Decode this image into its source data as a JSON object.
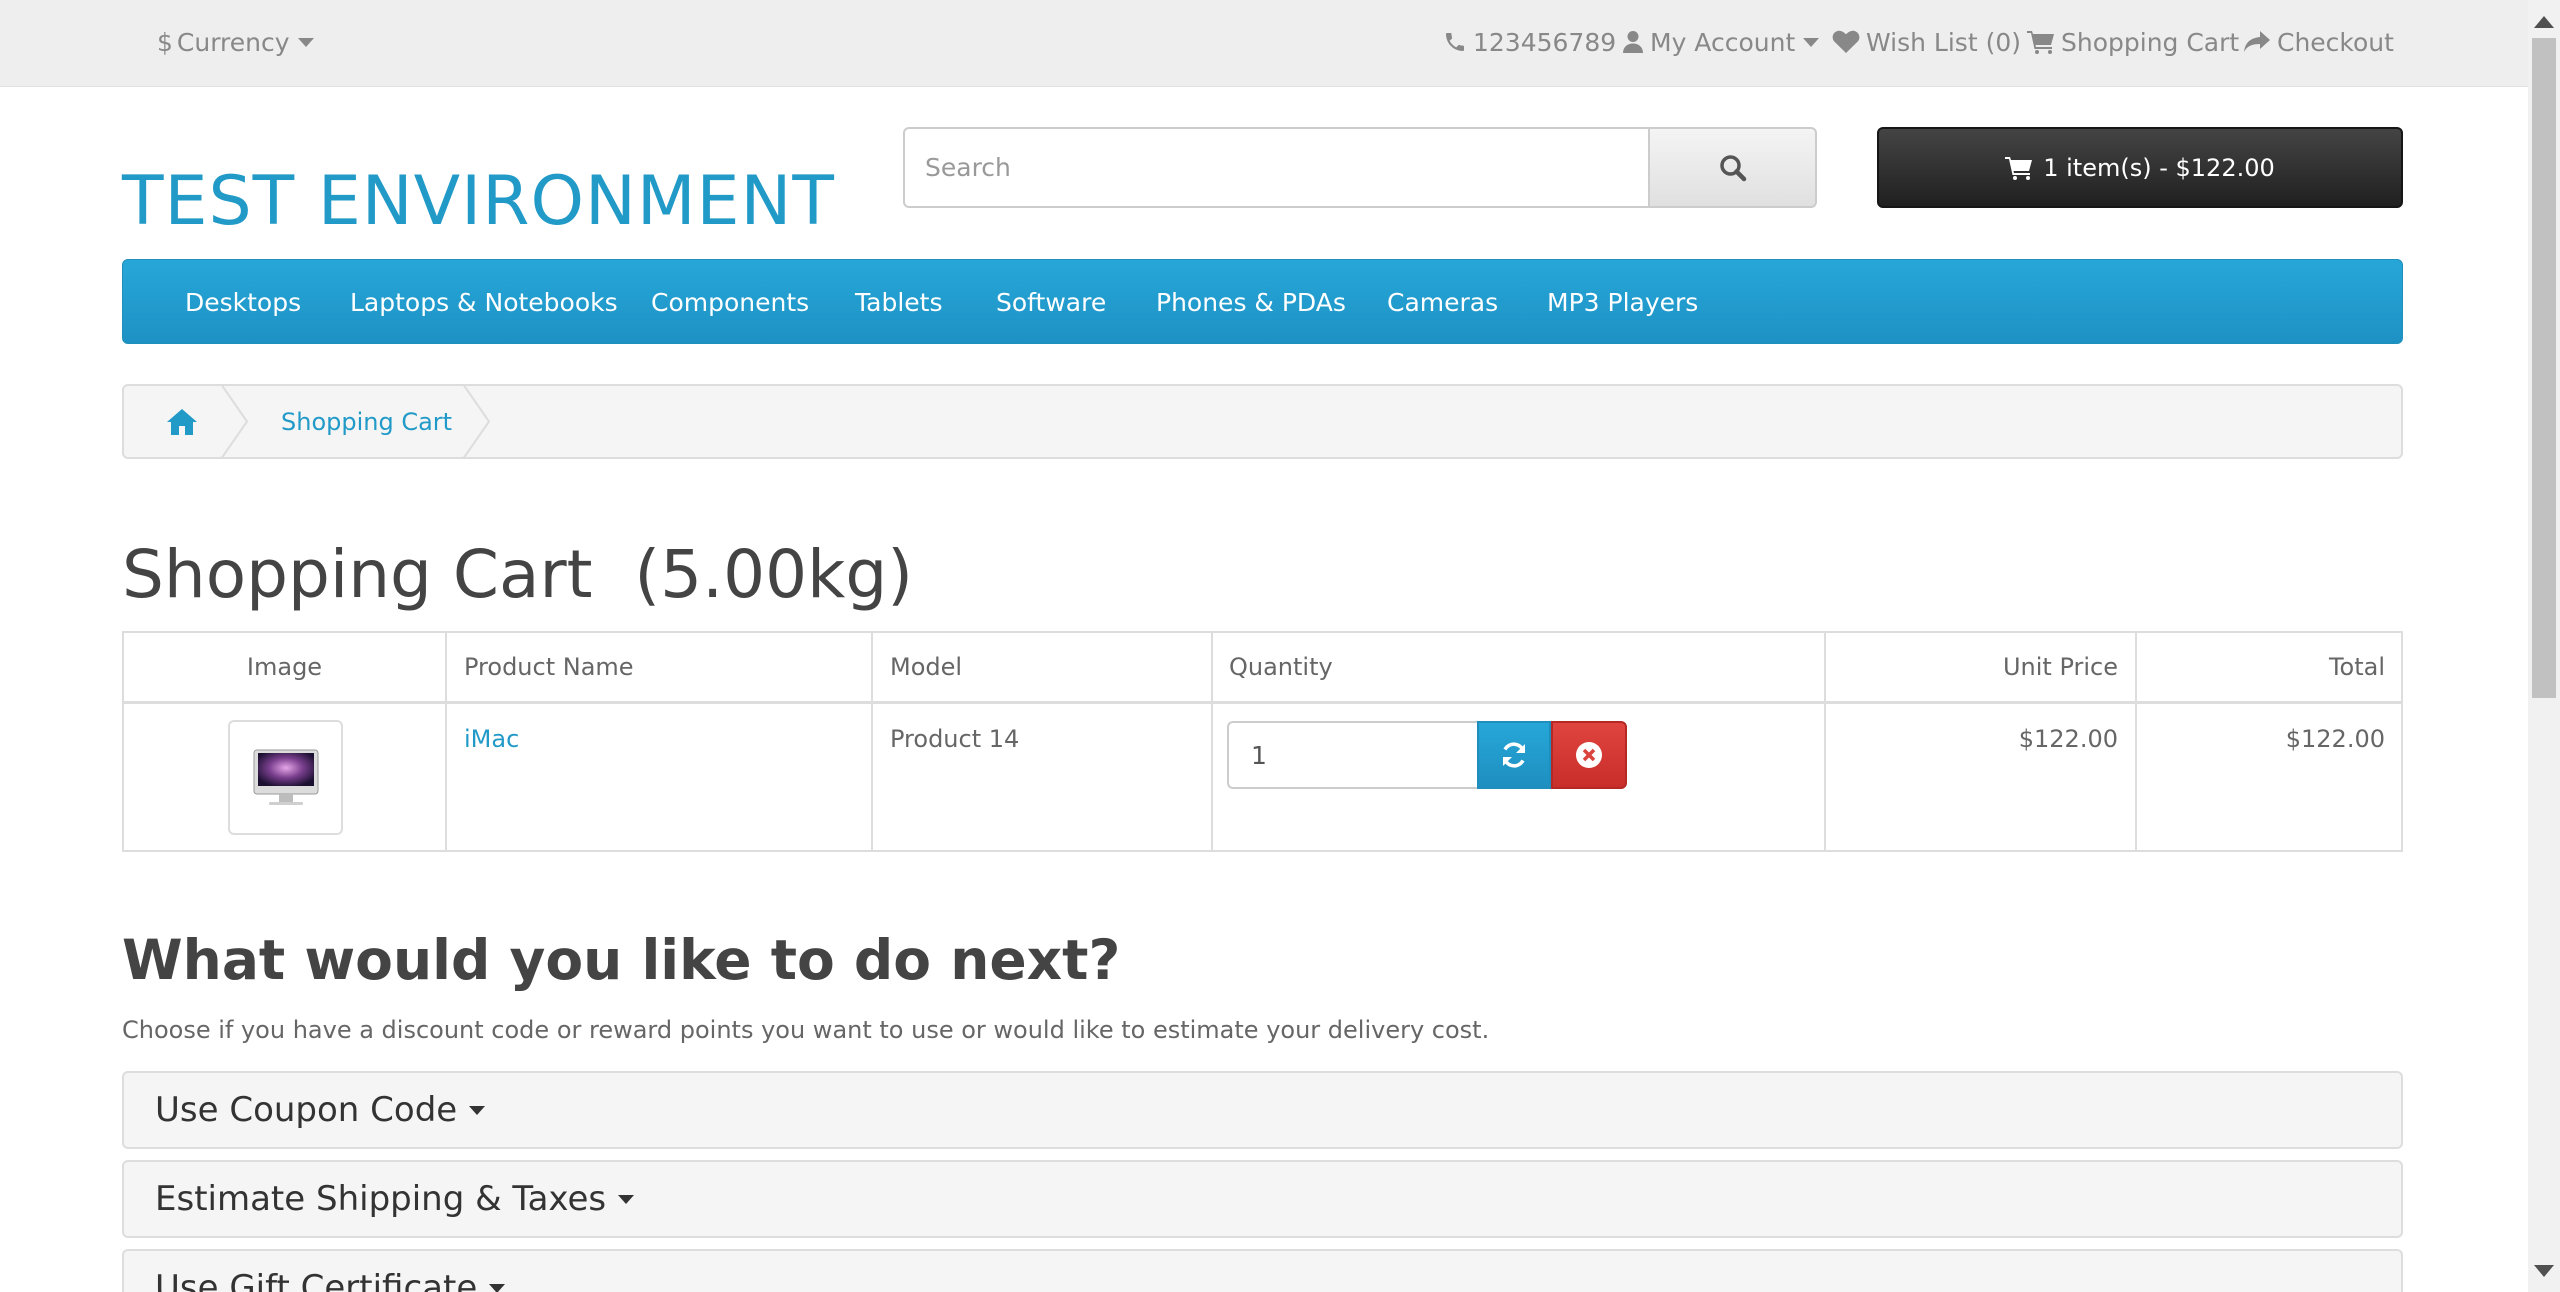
{
  "topbar": {
    "currency_label": "Currency",
    "currency_symbol": "$",
    "phone": "123456789",
    "my_account": "My Account",
    "wish_list": "Wish List (0)",
    "shopping_cart": "Shopping Cart",
    "checkout": "Checkout"
  },
  "header": {
    "logo": "TEST ENVIRONMENT",
    "search_placeholder": "Search",
    "cart_button": "1 item(s) - $122.00"
  },
  "menu": {
    "items": [
      "Desktops",
      "Laptops & Notebooks",
      "Components",
      "Tablets",
      "Software",
      "Phones & PDAs",
      "Cameras",
      "MP3 Players"
    ]
  },
  "breadcrumb": {
    "current": "Shopping Cart"
  },
  "page": {
    "title": "Shopping Cart  (5.00kg)"
  },
  "cart_table": {
    "headers": [
      "Image",
      "Product Name",
      "Model",
      "Quantity",
      "Unit Price",
      "Total"
    ],
    "rows": [
      {
        "product_name": "iMac",
        "model": "Product 14",
        "quantity": "1",
        "unit_price": "$122.00",
        "total": "$122.00"
      }
    ]
  },
  "next_section": {
    "title": "What would you like to do next?",
    "description": "Choose if you have a discount code or reward points you want to use or would like to estimate your delivery cost.",
    "panels": [
      "Use Coupon Code",
      "Estimate Shipping & Taxes",
      "Use Gift Certificate"
    ]
  },
  "colors": {
    "brand_blue": "#229ac8",
    "danger_red": "#da4f49",
    "cart_dark": "#363636"
  }
}
